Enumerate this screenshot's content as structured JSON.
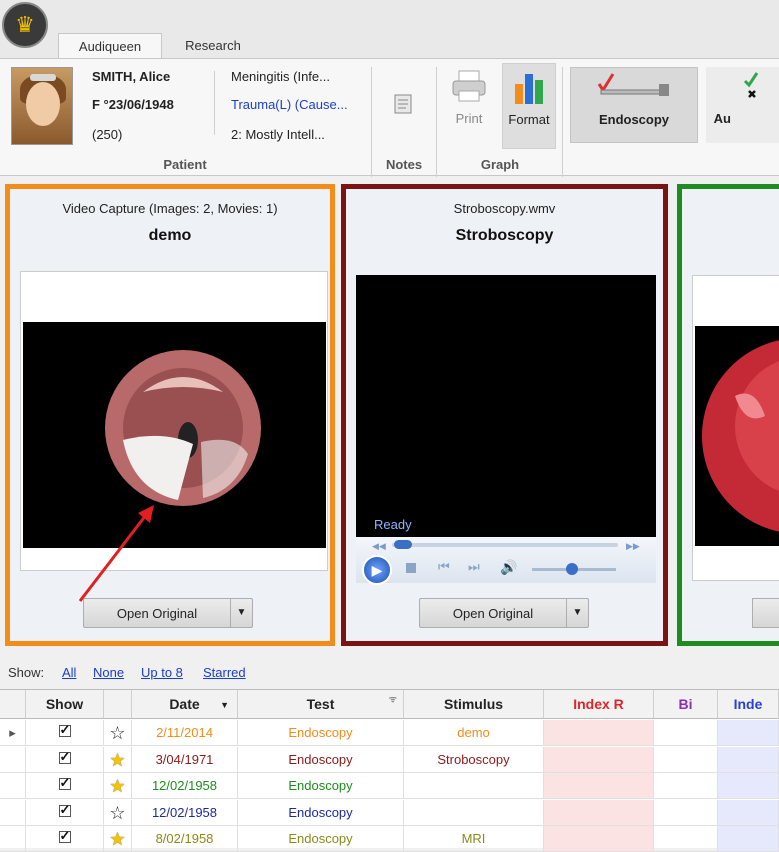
{
  "tabs": [
    "Audiqueen",
    "Research"
  ],
  "patient": {
    "name": "SMITH, Alice",
    "birth": "F °23/06/1948",
    "count": "(250)",
    "diag1": "Meningitis (Infe...",
    "diag2": "Trauma(L) (Cause...",
    "diag3": "2: Mostly Intell...",
    "group_label": "Patient"
  },
  "ribbon": {
    "notes_label": "Notes",
    "print_label": "Print",
    "format_label": "Format",
    "graph_label": "Graph",
    "endoscopy_label": "Endoscopy",
    "au_label": "Au"
  },
  "panels": [
    {
      "subtitle": "Video Capture (Images: 2, Movies: 1)",
      "title": "demo",
      "button": "Open Original",
      "color": "#f28c1a"
    },
    {
      "subtitle": "Stroboscopy.wmv",
      "title": "Stroboscopy",
      "button": "Open Original",
      "color": "#7a1414",
      "player_status": "Ready"
    },
    {
      "subtitle": "",
      "title": "",
      "button": "",
      "color": "#1f8c1f"
    }
  ],
  "show_filter": {
    "label": "Show:",
    "options": [
      "All",
      "None",
      "Up to 8",
      "Starred"
    ]
  },
  "table": {
    "headers": [
      "Show",
      "Date",
      "Test",
      "Stimulus",
      "Index R",
      "Bi",
      "Inde"
    ],
    "rows": [
      {
        "date": "2/11/2014",
        "test": "Endoscopy",
        "stimulus": "demo",
        "color": "#f28c1a",
        "starred": false,
        "selected": true
      },
      {
        "date": "3/04/1971",
        "test": "Endoscopy",
        "stimulus": "Stroboscopy",
        "color": "#8b1a1a",
        "starred": true,
        "selected": false
      },
      {
        "date": "12/02/1958",
        "test": "Endoscopy",
        "stimulus": "",
        "color": "#1f8c1f",
        "starred": true,
        "selected": false
      },
      {
        "date": "12/02/1958",
        "test": "Endoscopy",
        "stimulus": "",
        "color": "#1c2a9c",
        "starred": false,
        "selected": false
      },
      {
        "date": "8/02/1958",
        "test": "Endoscopy",
        "stimulus": "MRI",
        "color": "#8a8a1a",
        "starred": true,
        "selected": false
      }
    ]
  },
  "colors": {
    "index_r": "#e0242a",
    "bi": "#8a2fb0",
    "inde": "#2a3fd6"
  }
}
